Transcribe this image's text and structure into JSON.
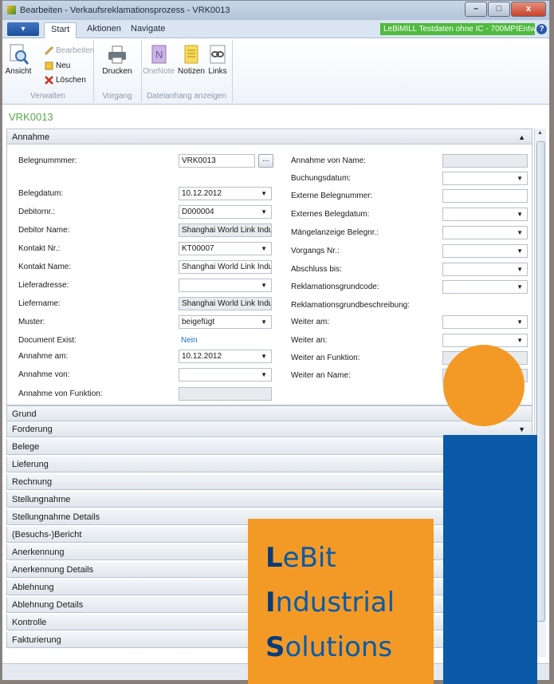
{
  "window": {
    "title": "Bearbeiten - Verkaufsreklamationsprozess - VRK0013",
    "minimize": "–",
    "maximize": "□",
    "close": "x"
  },
  "ribbon_tabs": {
    "app_menu": "▾",
    "start": "Start",
    "aktionen": "Aktionen",
    "navigate": "Navigate",
    "environment": "LeBiMILL Testdaten ohne IC - 700MPIEntwickl...",
    "help": "?"
  },
  "ribbon": {
    "verwalten": {
      "ansicht": "Ansicht",
      "bearbeiten": "Bearbeiten",
      "neu": "Neu",
      "loeschen": "Löschen",
      "label": "Verwalten"
    },
    "vorgang": {
      "drucken": "Drucken",
      "label": "Vorgang"
    },
    "dateianhang": {
      "onenote": "OneNote",
      "notizen": "Notizen",
      "links": "Links",
      "label": "Dateianhang anzeigen"
    }
  },
  "document_title": "VRK0013",
  "annahme": {
    "header": "Annahme",
    "left_fields": [
      {
        "label": "Belegnummmer:",
        "value": "VRK0013"
      },
      {
        "label": "Belegdatum:",
        "value": "10.12.2012"
      },
      {
        "label": "Debitornr.:",
        "value": "D000004"
      },
      {
        "label": "Debitor Name:",
        "value": "Shanghai World Link Indu..."
      },
      {
        "label": "Kontakt Nr.:",
        "value": "KT00007"
      },
      {
        "label": "Kontakt Name:",
        "value": "Shanghai World Link Indu..."
      },
      {
        "label": "Lieferadresse:",
        "value": ""
      },
      {
        "label": "Liefername:",
        "value": "Shanghai World Link Indu..."
      },
      {
        "label": "Muster:",
        "value": "beigefügt"
      },
      {
        "label": "Document Exist:",
        "value": "Nein"
      },
      {
        "label": "Annahme am:",
        "value": "10.12.2012"
      },
      {
        "label": "Annahme von:",
        "value": ""
      },
      {
        "label": "Annahme von Funktion:",
        "value": ""
      }
    ],
    "assist_button": "...",
    "right_fields": [
      {
        "label": "Annahme von Name:"
      },
      {
        "label": "Buchungsdatum:"
      },
      {
        "label": "Externe Belegnummer:"
      },
      {
        "label": "Externes Belegdatum:"
      },
      {
        "label": "Mängelanzeige Belegnr.:"
      },
      {
        "label": "Vorgangs Nr.:"
      },
      {
        "label": "Abschluss bis:"
      },
      {
        "label": "Reklamationsgrundcode:"
      },
      {
        "label": "Reklamationsgrundbeschreibung:"
      },
      {
        "label": "Weiter am:"
      },
      {
        "label": "Weiter an:"
      },
      {
        "label": "Weiter an Funktion:"
      },
      {
        "label": "Weiter an Name:"
      }
    ]
  },
  "fasttabs": [
    "Grund",
    "Forderung",
    "Belege",
    "Lieferung",
    "Rechnung",
    "Stellungnahme",
    "Stellungnahme Details",
    "(Besuchs-)Bericht",
    "Anerkennung",
    "Anerkennung Details",
    "Ablehnung",
    "Ablehnung Details",
    "Kontrolle",
    "Fakturierung"
  ],
  "brand": {
    "line1_initial": "L",
    "line1_rest": "eBit",
    "line2_initial": "I",
    "line2_rest": "ndustrial",
    "line3_initial": "S",
    "line3_rest": "olutions"
  },
  "colors": {
    "brand_orange": "#f39a26",
    "brand_blue": "#0a5aa8",
    "environment_green": "#4fba3e",
    "doc_title_green": "#5aa64a"
  }
}
